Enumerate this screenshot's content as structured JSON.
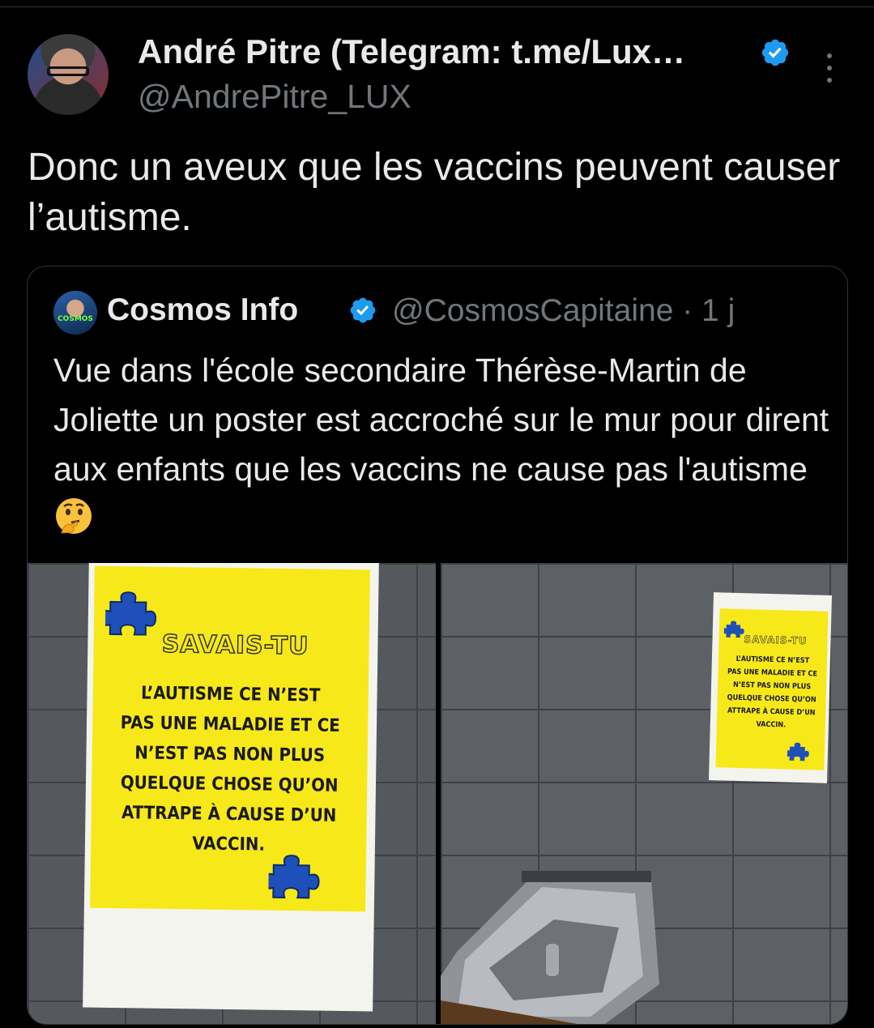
{
  "tweet": {
    "author_name": "André Pitre (Telegram: t.me/Lux…",
    "author_handle": "@AndrePitre_LUX",
    "text": "Donc un aveux que les vaccins peuvent causer l’autisme."
  },
  "quoted_tweet": {
    "author_name": "Cosmos Info",
    "author_handle_time": "@CosmosCapitaine · 1 j",
    "avatar_logo": "COSMOS",
    "text": "Vue dans l'école secondaire Thérèse-Martin de Joliette un poster est accroché sur le mur pour dirent aux enfants que les vaccins ne cause pas l'autisme",
    "emoji": "thinking-face",
    "photos": [
      {
        "poster_title": "SAVAIS-TU",
        "poster_lines": [
          "L’AUTISME CE N’EST",
          "PAS UNE MALADIE ET CE",
          "N’EST PAS NON PLUS",
          "QUELQUE CHOSE QU’ON",
          "ATTRAPE À CAUSE D’UN",
          "VACCIN."
        ]
      },
      {
        "poster_title": "SAVAIS-TU",
        "poster_lines": [
          "L’AUTISME CE N’EST",
          "PAS UNE MALADIE ET CE",
          "N’EST PAS NON PLUS",
          "QUELQUE CHOSE QU’ON",
          "ATTRAPE À CAUSE D’UN",
          "VACCIN."
        ]
      }
    ]
  },
  "icons": {
    "verified": "verified-badge-icon",
    "more": "more-options-icon",
    "puzzle": "puzzle-piece-icon"
  },
  "colors": {
    "background": "#000000",
    "text": "#e7e9ea",
    "muted": "#71767b",
    "verified": "#1d9bf0",
    "poster_yellow": "#f7e81a",
    "puzzle_blue": "#1f4fb8"
  }
}
